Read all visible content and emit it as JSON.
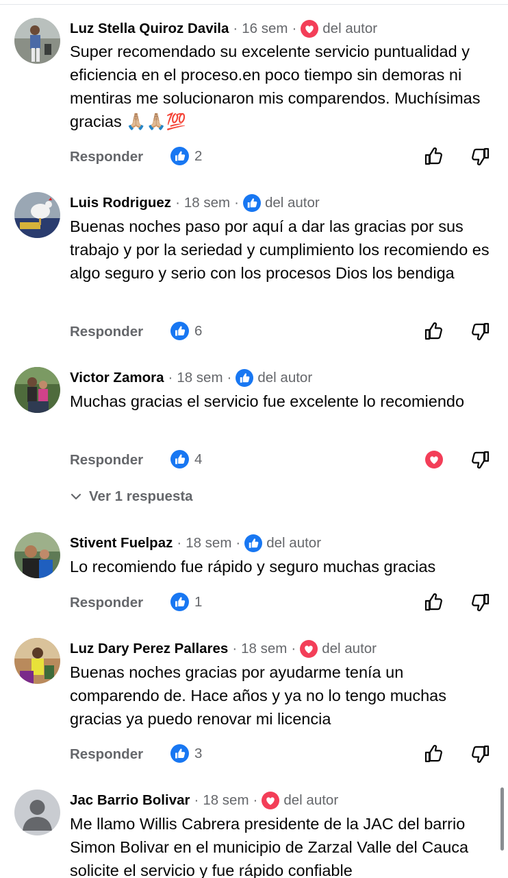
{
  "labels": {
    "reply": "Responder",
    "author_badge": "del autor",
    "dot": "·"
  },
  "colors": {
    "like_blue": "#1877f2",
    "love_red": "#f33e58",
    "secondary_text": "#65676b"
  },
  "comments": [
    {
      "name": "Luz Stella Quiroz Davila",
      "time": "16 sem",
      "author_reaction": "heart",
      "text": "Super recomendado su excelente servicio puntualidad y eficiencia en el proceso.en poco tiempo sin demoras ni mentiras me solucionaron mis comparendos. Muchísimas gracias 🙏🏼🙏🏼💯",
      "likes": "2",
      "user_reaction": "none"
    },
    {
      "name": "Luis Rodriguez",
      "time": "18 sem",
      "author_reaction": "like",
      "text": "Buenas noches  paso por aquí a dar las gracias  por sus trabajo  y por la seriedad  y cumplimiento los recomiendo es algo seguro y serio con los procesos Dios los bendiga",
      "likes": "6",
      "user_reaction": "none"
    },
    {
      "name": "Victor Zamora",
      "time": "18 sem",
      "author_reaction": "like",
      "text": "Muchas gracias el servicio fue excelente lo recomiendo",
      "likes": "4",
      "user_reaction": "heart",
      "replies_label": "Ver 1 respuesta"
    },
    {
      "name": "Stivent Fuelpaz",
      "time": "18 sem",
      "author_reaction": "like",
      "text": "Lo recomiendo fue rápido y seguro muchas gracias",
      "likes": "1",
      "user_reaction": "none"
    },
    {
      "name": "Luz Dary Perez Pallares",
      "time": "18 sem",
      "author_reaction": "heart",
      "text": "Buenas noches gracias por ayudarme tenía un comparendo de. Hace años y ya no lo tengo muchas gracias ya puedo renovar mi licencia",
      "likes": "3",
      "user_reaction": "none"
    },
    {
      "name": "Jac Barrio Bolivar",
      "time": "18 sem",
      "author_reaction": "heart",
      "text": "Me llamo Willis Cabrera presidente de la JAC del barrio Simon Bolivar en el municipio de Zarzal Valle del Cauca  solicite el servicio y fue rápido confiable",
      "likes": "",
      "user_reaction": "none"
    }
  ]
}
